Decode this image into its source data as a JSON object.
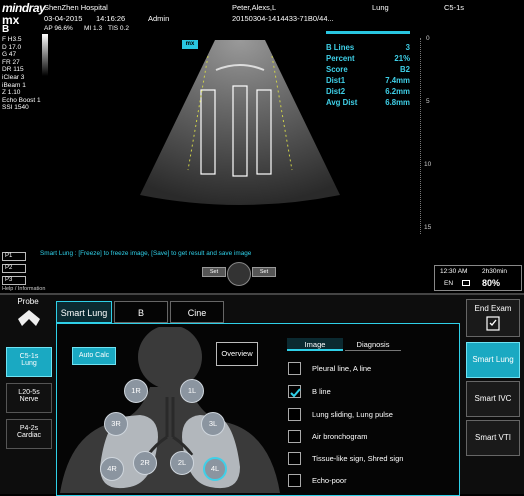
{
  "header": {
    "brand": "mindray",
    "hospital": "ShenZhen Hospital",
    "patient": "Peter,Alexs,L",
    "mode_label": "Lung",
    "probe_code": "C5-1s",
    "date": "03-04-2015",
    "time": "14:16:26",
    "operator": "Admin",
    "exam_id": "20150304-1414433-71B0/44...",
    "ap": "AP 96.6%",
    "mi": "MI 1.3",
    "tis": "TIS 0.2",
    "mx": "mx",
    "b": "B"
  },
  "params": [
    "F H3.5",
    "D 17.0",
    "G 47",
    "FR 27",
    "DR 115",
    "iClear 3",
    "iBeam 1",
    "Z 1.10",
    "Echo Boost 1",
    "SSI 1540"
  ],
  "image_badge": "mx",
  "measurements": [
    {
      "label": "B Lines",
      "value": "3"
    },
    {
      "label": "Percent",
      "value": "21%"
    },
    {
      "label": "Score",
      "value": "B2"
    },
    {
      "label": "Dist1",
      "value": "7.4mm"
    },
    {
      "label": "Dist2",
      "value": "6.2mm"
    },
    {
      "label": "Avg Dist",
      "value": "6.8mm"
    }
  ],
  "depth_scale": [
    "0",
    "5",
    "10",
    "15"
  ],
  "hint": "Smart Lung : [Freeze] to freeze image, [Save] to get result and save image",
  "presets": [
    "P1",
    "P2",
    "P3"
  ],
  "set_left": "Set",
  "set_right": "Set",
  "help": "Help / Information",
  "status": {
    "clock": "12:30 AM",
    "lang": "EN",
    "timer": "2h30min",
    "battery": "80%"
  },
  "probe_panel": {
    "title": "Probe",
    "items": [
      {
        "label": "C5-1s\nLung",
        "active": true
      },
      {
        "label": "L20-5s\nNerve",
        "active": false
      },
      {
        "label": "P4-2s\nCardiac",
        "active": false
      }
    ]
  },
  "tabs": [
    {
      "label": "Smart Lung",
      "active": true
    },
    {
      "label": "B",
      "active": false
    },
    {
      "label": "Cine",
      "active": false
    }
  ],
  "auto_calc": "Auto Calc",
  "overview": "Overview",
  "regions": [
    {
      "label": "1R",
      "sel": false
    },
    {
      "label": "1L",
      "sel": false
    },
    {
      "label": "3R",
      "sel": false
    },
    {
      "label": "3L",
      "sel": false
    },
    {
      "label": "2R",
      "sel": false
    },
    {
      "label": "2L",
      "sel": false
    },
    {
      "label": "4R",
      "sel": false
    },
    {
      "label": "4L",
      "sel": true
    }
  ],
  "subtabs": [
    {
      "label": "Image",
      "active": true
    },
    {
      "label": "Diagnosis",
      "active": false
    }
  ],
  "signs": [
    {
      "label": "Pleural line, A line",
      "checked": false
    },
    {
      "label": "B line",
      "checked": true
    },
    {
      "label": "Lung sliding, Lung pulse",
      "checked": false
    },
    {
      "label": "Air bronchogram",
      "checked": false
    },
    {
      "label": "Tissue-like sign, Shred sign",
      "checked": false
    },
    {
      "label": "Echo-poor",
      "checked": false
    }
  ],
  "right_panel": {
    "end_exam": "End Exam",
    "buttons": [
      {
        "label": "Smart Lung",
        "active": true
      },
      {
        "label": "Smart IVC",
        "active": false
      },
      {
        "label": "Smart VTI",
        "active": false
      }
    ]
  },
  "colors": {
    "accent": "#2fd0e8",
    "active_fill": "#1aa9c2"
  }
}
